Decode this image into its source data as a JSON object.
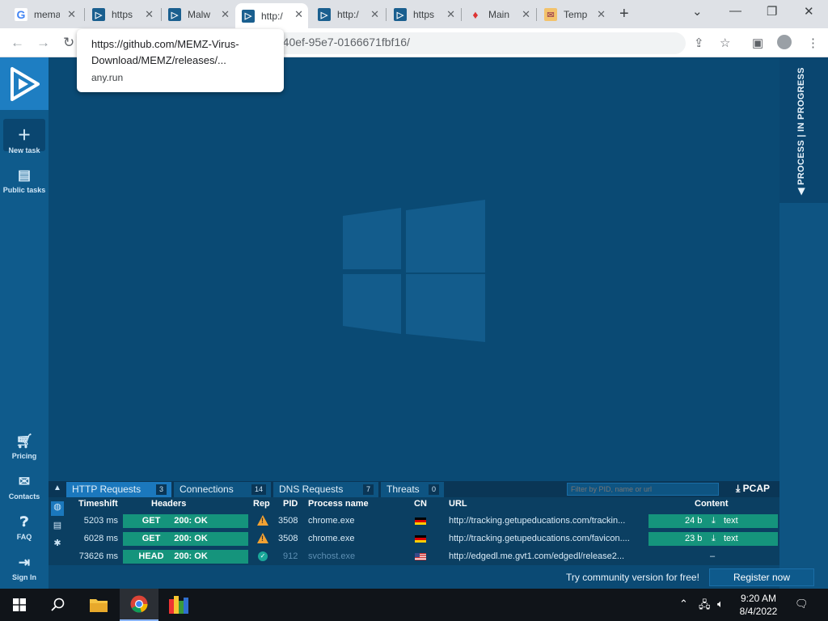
{
  "browser": {
    "tabs": [
      {
        "title": "mema",
        "icon": "google-icon"
      },
      {
        "title": "https",
        "icon": "anyrun-icon"
      },
      {
        "title": "Malw",
        "icon": "anyrun-icon"
      },
      {
        "title": "http:/",
        "icon": "anyrun-icon",
        "active": true
      },
      {
        "title": "http:/",
        "icon": "anyrun-icon"
      },
      {
        "title": "https",
        "icon": "anyrun-icon"
      },
      {
        "title": "Main",
        "icon": "fire-icon"
      },
      {
        "title": "Temp",
        "icon": "mail-icon"
      }
    ],
    "address_visible": "-40ef-95e7-0166671fbf16/",
    "tooltip": {
      "url": "https://github.com/MEMZ-Virus-Download/MEMZ/releases/...",
      "host": "any.run"
    }
  },
  "sidebar": {
    "items": [
      {
        "label": "New task",
        "icon": "plus-icon"
      },
      {
        "label": "Public tasks",
        "icon": "document-icon"
      },
      {
        "label": "Pricing",
        "icon": "cart-icon"
      },
      {
        "label": "Contacts",
        "icon": "mail-icon"
      },
      {
        "label": "FAQ",
        "icon": "help-icon"
      },
      {
        "label": "Sign In",
        "icon": "signin-icon"
      }
    ]
  },
  "right_panel": {
    "label": "PROCESS | IN PROGRESS"
  },
  "network": {
    "tabs": [
      {
        "label": "HTTP Requests",
        "count": "3",
        "active": true
      },
      {
        "label": "Connections",
        "count": "14"
      },
      {
        "label": "DNS Requests",
        "count": "7"
      },
      {
        "label": "Threats",
        "count": "0"
      }
    ],
    "filter_placeholder": "Filter by PID, name or url",
    "pcap_label": "PCAP",
    "columns": [
      "Timeshift",
      "Headers",
      "Rep",
      "PID",
      "Process name",
      "CN",
      "URL",
      "Content"
    ],
    "rows": [
      {
        "timeshift": "5203 ms",
        "method": "GET",
        "status": "200: OK",
        "rep": "warning",
        "pid": "3508",
        "process": "chrome.exe",
        "cn": "de",
        "url": "http://tracking.getupeducations.com/trackin...",
        "content_size": "24 b",
        "content_type": "text"
      },
      {
        "timeshift": "6028 ms",
        "method": "GET",
        "status": "200: OK",
        "rep": "warning",
        "pid": "3508",
        "process": "chrome.exe",
        "cn": "de",
        "url": "http://tracking.getupeducations.com/favicon....",
        "content_size": "23 b",
        "content_type": "text"
      },
      {
        "timeshift": "73626 ms",
        "method": "HEAD",
        "status": "200: OK",
        "rep": "ok",
        "pid": "912",
        "process": "svchost.exe",
        "cn": "us",
        "url": "http://edgedl.me.gvt1.com/edgedl/release2...",
        "content_size": "",
        "content_type": "–"
      }
    ]
  },
  "footer": {
    "community_text": "Try community version for free!",
    "register_label": "Register now"
  },
  "taskbar": {
    "time": "9:20 AM",
    "date": "8/4/2022"
  },
  "colors": {
    "vm_bg": "#0a4a74",
    "accent": "#1b78bd",
    "status_green": "#15947c",
    "warning": "#f2a233"
  }
}
